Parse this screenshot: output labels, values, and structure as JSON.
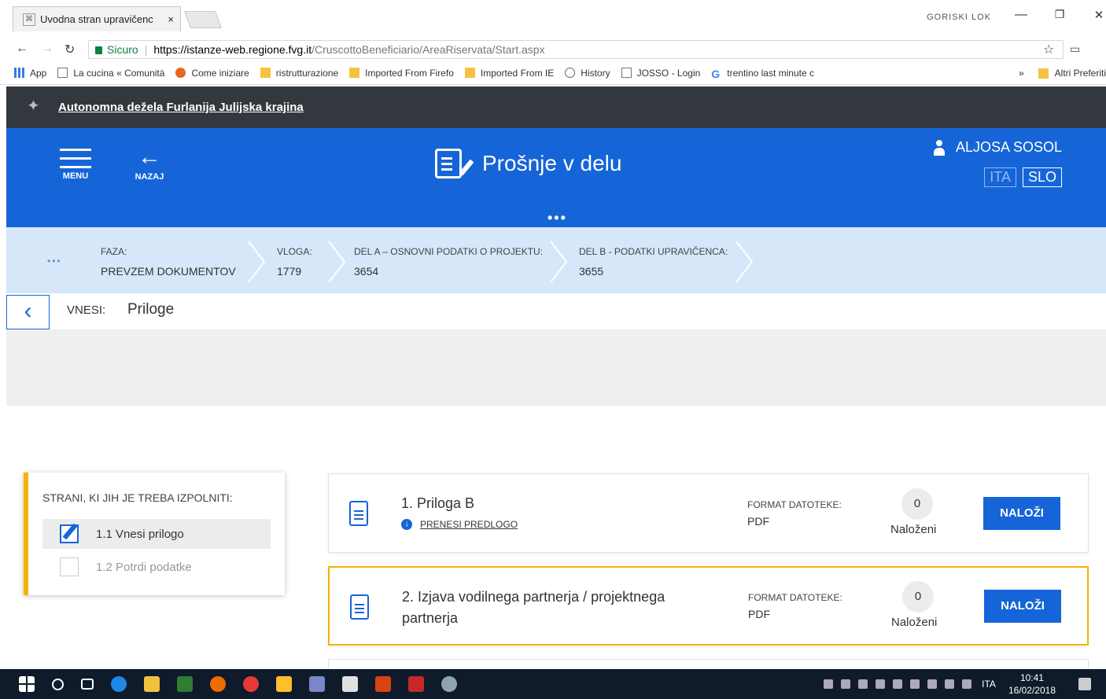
{
  "browser": {
    "tab_title": "Uvodna stran upravičenc",
    "tab_close": "×",
    "profile_label": "GORISKI LOK",
    "win_min": "—",
    "win_max": "❐",
    "win_close": "✕",
    "secure_label": "Sicuro",
    "url_host": "https://istanze-web.regione.fvg.it",
    "url_path": "/CruscottoBeneficiario/AreaRiservata/Start.aspx",
    "bookmarks": [
      {
        "label": "App",
        "icon": "apps-icon"
      },
      {
        "label": "La cucina « Comunità",
        "icon": "page-icon"
      },
      {
        "label": "Come iniziare",
        "icon": "firefox-icon"
      },
      {
        "label": "ristrutturazione",
        "icon": "folder-icon"
      },
      {
        "label": "Imported From Firefo",
        "icon": "folder-icon"
      },
      {
        "label": "Imported From IE",
        "icon": "folder-icon"
      },
      {
        "label": "History",
        "icon": "history-icon"
      },
      {
        "label": "JOSSO - Login",
        "icon": "page-icon"
      },
      {
        "label": "trentino last minute c",
        "icon": "google-icon"
      }
    ],
    "bookmarks_more": "»",
    "bookmarks_other": "Altri Preferiti"
  },
  "region": {
    "name": "Autonomna dežela Furlanija Julijska krajina"
  },
  "header": {
    "menu_label": "MENU",
    "back_label": "NAZAJ",
    "back_arrow": "←",
    "title": "Prošnje v delu",
    "user_name": "ALJOSA SOSOL",
    "lang_ita": "ITA",
    "lang_slo": "SLO",
    "dots": "•••"
  },
  "breadcrumbs": {
    "dots": "•••",
    "items": [
      {
        "key": "FAZA:",
        "value": "PREVZEM DOKUMENTOV"
      },
      {
        "key": "VLOGA:",
        "value": "1779"
      },
      {
        "key": "DEL A – OSNOVNI PODATKI O PROJEKTU:",
        "value": "3654"
      },
      {
        "key": "DEL B - PODATKI UPRAVIČENCA:",
        "value": "3655"
      }
    ]
  },
  "step": {
    "prev_glyph": "‹",
    "label": "VNESI:",
    "value": "Priloge"
  },
  "steps_panel": {
    "heading": "STRANI, KI JIH JE TREBA IZPOLNITI:",
    "items": [
      {
        "label": "1.1 Vnesi prilogo",
        "state": "active"
      },
      {
        "label": "1.2 Potrdi podatke",
        "state": "pending"
      }
    ]
  },
  "attachments": [
    {
      "name": "1. Priloga B",
      "download_label": "PRENESI PREDLOGO",
      "format_key": "FORMAT DATOTEKE:",
      "format_value": "PDF",
      "count": "0",
      "count_label": "Naloženi",
      "upload_label": "NALOŽI"
    },
    {
      "name": "2. Izjava vodilnega partnerja / projektnega partnerja",
      "format_key": "FORMAT DATOTEKE:",
      "format_value": "PDF",
      "count": "0",
      "count_label": "Naloženi",
      "upload_label": "NALOŽI"
    }
  ],
  "taskbar": {
    "lang": "ITA",
    "time": "10:41",
    "date": "16/02/2018"
  }
}
